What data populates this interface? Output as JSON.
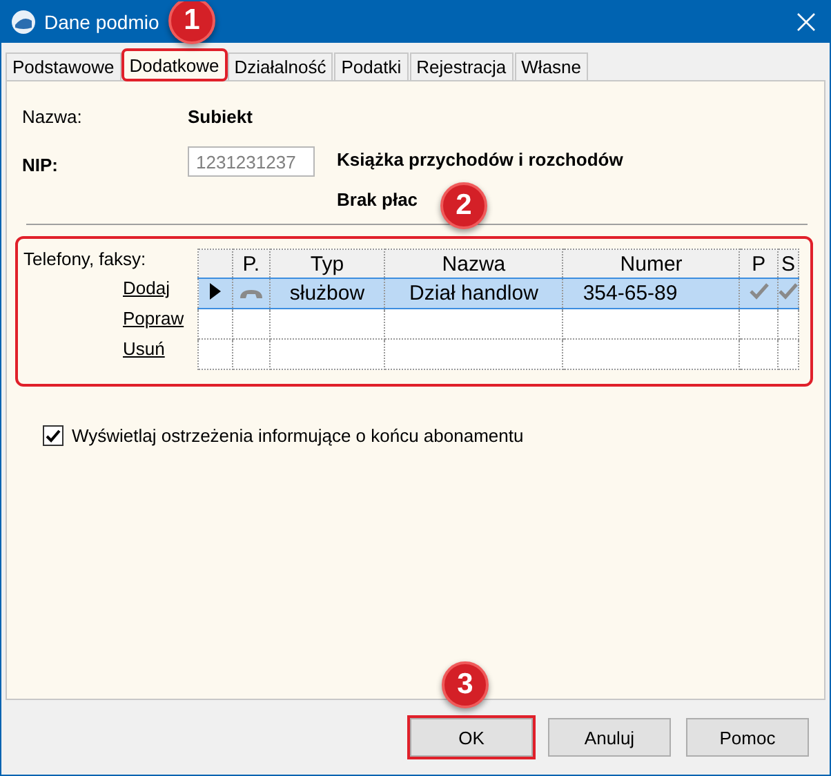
{
  "window": {
    "title": "Dane podmio"
  },
  "tabs": [
    {
      "label": "Podstawowe",
      "selected": false,
      "highlighted": false
    },
    {
      "label": "Dodatkowe",
      "selected": true,
      "highlighted": true,
      "badge": "1"
    },
    {
      "label": "Działalność",
      "selected": false,
      "highlighted": false
    },
    {
      "label": "Podatki",
      "selected": false,
      "highlighted": false
    },
    {
      "label": "Rejestracja",
      "selected": false,
      "highlighted": false
    },
    {
      "label": "Własne",
      "selected": false,
      "highlighted": false
    }
  ],
  "fields": {
    "name_label": "Nazwa:",
    "name_value": "Subiekt",
    "nip_label": "NIP:",
    "nip_value": "1231231237",
    "book_type": "Książka przychodów i rozchodów",
    "payroll": "Brak płac"
  },
  "phones": {
    "label": "Telefony, faksy:",
    "highlighted": true,
    "badge": "2",
    "actions": [
      "Dodaj",
      "Popraw",
      "Usuń"
    ],
    "columns": [
      "P.",
      "Typ",
      "Nazwa",
      "Numer",
      "P",
      "S"
    ],
    "rows": [
      {
        "current": true,
        "selected": true,
        "kind": "phone",
        "type": "służbow",
        "name": "Dział handlow",
        "number": "354-65-89",
        "p": true,
        "s": true
      }
    ]
  },
  "warning_checkbox": {
    "label": "Wyświetlaj ostrzeżenia informujące o końcu abonamentu",
    "checked": true
  },
  "buttons": [
    {
      "label": "OK",
      "highlighted": true,
      "badge": "3"
    },
    {
      "label": "Anuluj",
      "highlighted": false
    },
    {
      "label": "Pomoc",
      "highlighted": false
    }
  ]
}
